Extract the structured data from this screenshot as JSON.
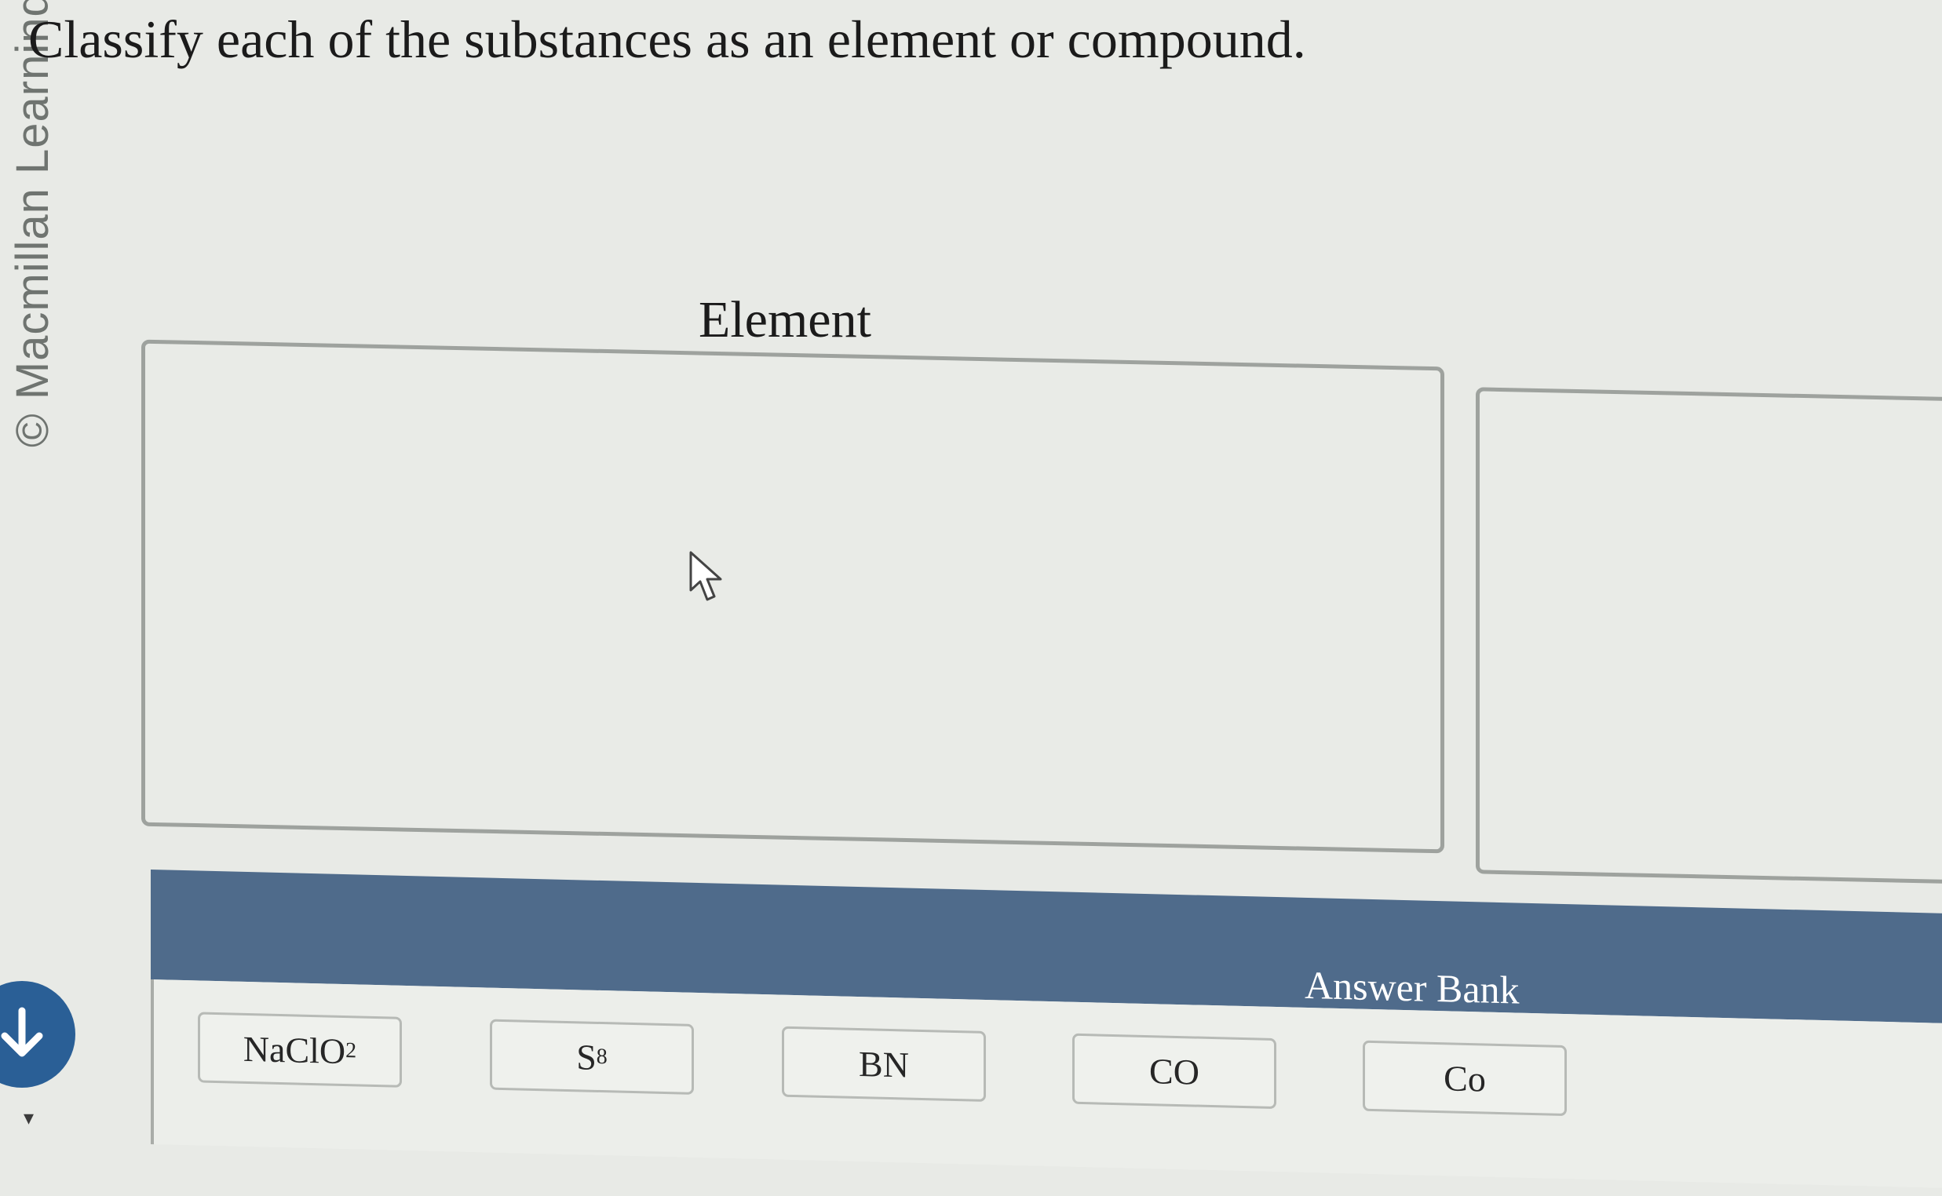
{
  "watermark": "© Macmillan Learning",
  "question": "Classify each of the substances as an element or compound.",
  "zones": {
    "element_title": "Element"
  },
  "answer_bank": {
    "title": "Answer Bank",
    "tiles": [
      {
        "main": "NaClO",
        "sub": "2"
      },
      {
        "main": "S",
        "sub": "8"
      },
      {
        "main": "BN",
        "sub": ""
      },
      {
        "main": "CO",
        "sub": ""
      },
      {
        "main": "Co",
        "sub": ""
      }
    ]
  },
  "colors": {
    "bank_header": "#4f6b8b",
    "nav_button": "#2a5f96"
  },
  "icons": [
    "arrow-down-icon",
    "mouse-pointer-icon",
    "caret-down-icon"
  ]
}
